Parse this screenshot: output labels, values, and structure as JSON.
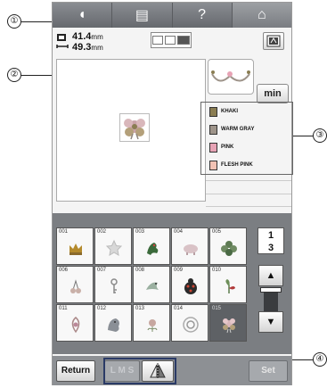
{
  "callouts": {
    "c1": "①",
    "c2": "②",
    "c3": "③",
    "c4": "④"
  },
  "topbar": {
    "buttons": [
      {
        "icon": "needle-icon",
        "glyph": "◖"
      },
      {
        "icon": "page-icon",
        "glyph": "▤"
      },
      {
        "icon": "help-icon",
        "glyph": "?"
      },
      {
        "icon": "home-icon",
        "glyph": "⌂"
      }
    ]
  },
  "pattern_size": {
    "width_value": "41.4",
    "height_value": "49.3",
    "unit": "mm"
  },
  "min_button": "min",
  "thread_colors": [
    {
      "name": "KHAKI",
      "color": "#8a7d52"
    },
    {
      "name": "WARM GRAY",
      "color": "#9e948a"
    },
    {
      "name": "PINK",
      "color": "#e7a3b5"
    },
    {
      "name": "FLESH PINK",
      "color": "#f2c2b4"
    }
  ],
  "pattern_cells": [
    {
      "num": "001",
      "icon": "crown-icon"
    },
    {
      "num": "002",
      "icon": "star-icon"
    },
    {
      "num": "003",
      "icon": "dragon-icon"
    },
    {
      "num": "004",
      "icon": "pig-icon"
    },
    {
      "num": "005",
      "icon": "flower-icon"
    },
    {
      "num": "006",
      "icon": "cherry-icon"
    },
    {
      "num": "007",
      "icon": "key-icon"
    },
    {
      "num": "008",
      "icon": "bird-icon"
    },
    {
      "num": "009",
      "icon": "ladybug-icon"
    },
    {
      "num": "010",
      "icon": "plant-icon"
    },
    {
      "num": "011",
      "icon": "ornament-icon"
    },
    {
      "num": "012",
      "icon": "lion-icon"
    },
    {
      "num": "013",
      "icon": "floral-icon"
    },
    {
      "num": "014",
      "icon": "rosette-icon"
    },
    {
      "num": "015",
      "icon": "flower-motif-icon"
    }
  ],
  "pager": {
    "current": "1",
    "total": "3"
  },
  "scroll_up": "▲",
  "scroll_down": "▼",
  "bottombar": {
    "return_label": "Return",
    "lms_label": "L M S",
    "set_label": "Set"
  }
}
